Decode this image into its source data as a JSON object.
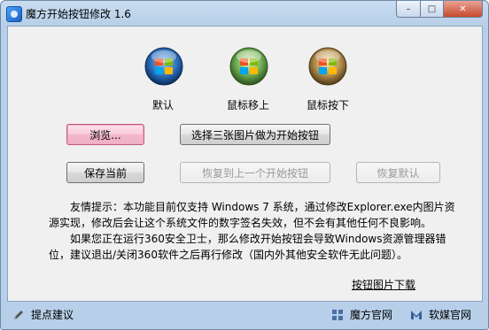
{
  "window": {
    "title": "魔方开始按钮修改 1.6"
  },
  "window_controls": {
    "minimize": "–",
    "maximize": "□",
    "close": "✕"
  },
  "orbs": [
    {
      "label": "默认"
    },
    {
      "label": "鼠标移上"
    },
    {
      "label": "鼠标按下"
    }
  ],
  "buttons": {
    "browse": "浏览...",
    "select_three": "选择三张图片做为开始按钮",
    "save_current": "保存当前",
    "restore_previous": "恢复到上一个开始按钮",
    "restore_default": "恢复默认"
  },
  "tip": {
    "line1": "友情提示：本功能目前仅支持 Windows 7 系统，通过修改Explorer.exe内图片资源实现，修改后会让这个系统文件的数字签名失效，但不会有其他任何不良影响。",
    "line2": "如果您正在运行360安全卫士，那么修改开始按钮会导致Windows资源管理器错位，建议退出/关闭360软件之后再行修改（国内外其他安全软件无此问题）。"
  },
  "links": {
    "download": "按钮图片下载"
  },
  "footer": {
    "feedback": "提点建议",
    "official_site": "魔方官网",
    "ruanmei_site": "软媒官网"
  }
}
